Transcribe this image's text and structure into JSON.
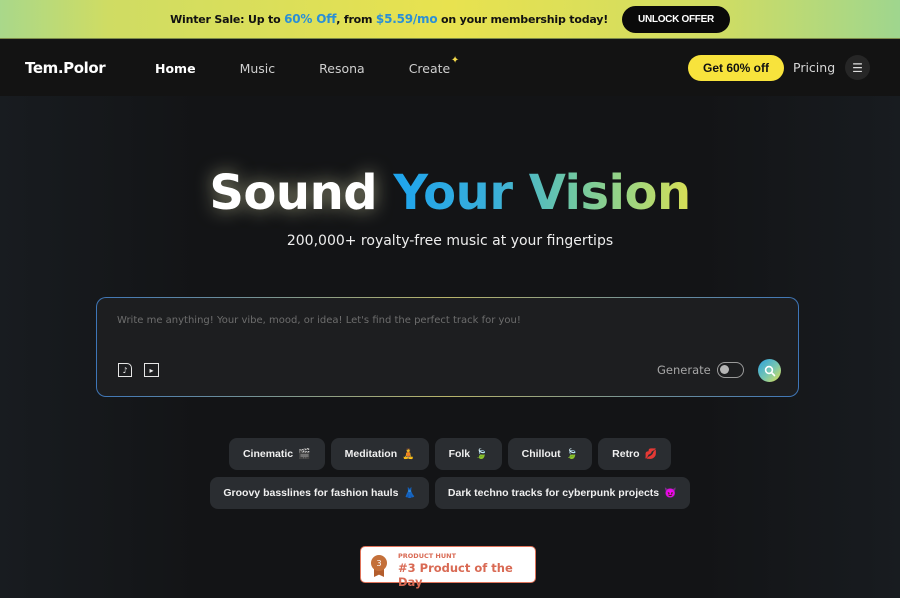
{
  "banner": {
    "text_prefix": "Winter Sale: Up to ",
    "discount": "60% Off",
    "text_mid": ", from ",
    "price": "$5.59/mo",
    "text_suffix": " on your membership today!",
    "button_label": "UNLOCK OFFER"
  },
  "header": {
    "logo": "Tem.Polor",
    "nav": [
      {
        "label": "Home",
        "active": true
      },
      {
        "label": "Music"
      },
      {
        "label": "Resona"
      },
      {
        "label": "Create"
      }
    ],
    "cta_label": "Get 60% off",
    "pricing_label": "Pricing",
    "menu_icon": "hamburger-menu-icon"
  },
  "hero": {
    "title_word1": "Sound",
    "title_word2": "Your Vision",
    "subtitle": "200,000+ royalty-free music at your fingertips"
  },
  "search": {
    "placeholder": "Write me anything! Your vibe, mood, or idea! Let's find the perfect track for you!",
    "value": "",
    "generate_label": "Generate",
    "generate_on": false,
    "icons": [
      "audio-file-icon",
      "video-file-icon",
      "search-icon"
    ]
  },
  "chips": {
    "row1": [
      {
        "label": "Cinematic",
        "emoji": "🎬"
      },
      {
        "label": "Meditation",
        "emoji": "🧘"
      },
      {
        "label": "Folk",
        "emoji": "🍃"
      },
      {
        "label": "Chillout",
        "emoji": "🍃"
      },
      {
        "label": "Retro",
        "emoji": "💋"
      }
    ],
    "row2": [
      {
        "label": "Groovy basslines for fashion hauls",
        "emoji": "👗"
      },
      {
        "label": "Dark techno tracks for cyberpunk projects",
        "emoji": "😈"
      }
    ]
  },
  "product_hunt": {
    "kicker": "PRODUCT HUNT",
    "title": "#3 Product of the Day",
    "rank": "3"
  },
  "colors": {
    "cta_yellow": "#f8e33c",
    "accent_blue": "#1ea4ee",
    "background": "#131416"
  }
}
